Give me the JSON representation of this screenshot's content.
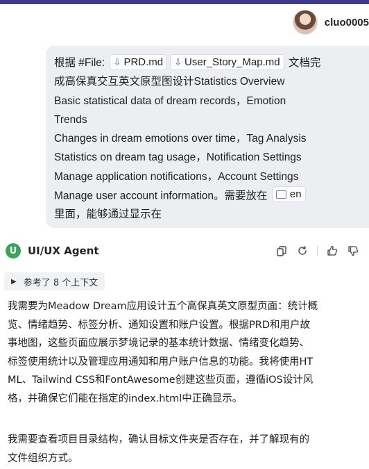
{
  "user": {
    "name": "cluo0005"
  },
  "user_message": {
    "line1_prefix": "根据 #File:",
    "file1": "PRD.md",
    "file2": "User_Story_Map.md",
    "line1_suffix": "文档完",
    "lines": [
      "成高保真交互英文原型图设计Statistics Overview",
      "Basic statistical data of dream records，Emotion",
      "Trends",
      "Changes in dream emotions over time，Tag Analysis",
      "Statistics on dream tag usage，Notification Settings",
      "Manage application notifications，Account Settings"
    ],
    "last_line_prefix": "Manage user account information。需要放在",
    "folder": "en",
    "final_line": "里面，能够通过显示在"
  },
  "agent": {
    "avatar_letter": "U",
    "name": "UI/UX Agent",
    "context_label": "参考了 8 个上下文"
  },
  "response": {
    "paragraph1": [
      "我需要为Meadow Dream应用设计五个高保真英文原型页面：统计概",
      "览、情绪趋势、标签分析、通知设置和账户设置。根据PRD和用户故",
      "事地图，这些页面应展示梦境记录的基本统计数据、情绪变化趋势、",
      "标签使用统计以及管理应用通知和用户账户信息的功能。我将使用HT",
      "ML、Tailwind CSS和FontAwesome创建这些页面，遵循iOS设计风",
      "格，并确保它们能在指定的index.html中正确显示。"
    ],
    "paragraph2": [
      "我需要查看项目目录结构，确认目标文件夹是否存在，并了解现有的",
      "文件组织方式。"
    ]
  },
  "colors": {
    "topbar": "#3d3a8f",
    "user_bubble": "#eceef2",
    "agent_avatar": "#3aa55a",
    "file_icon": "#3b6ed8"
  }
}
